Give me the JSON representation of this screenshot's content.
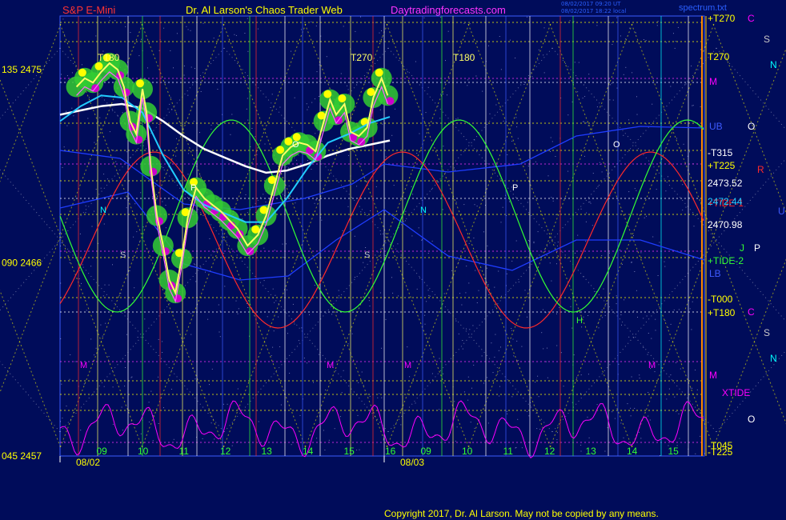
{
  "header": {
    "symbol": "S&P E-Mini",
    "site_title": "Dr. Al Larson's Chaos Trader Web",
    "url": "Daytradingforecasts.com",
    "stamp_line1": "08/02/2017 09:20 UT",
    "stamp_line2": "08/02/2017 18:22 local",
    "spectrum": "spectrum.txt"
  },
  "copyright": "Copyright 2017, Dr. Al Larson. May not be copied by any means.",
  "chart_data": {
    "type": "line",
    "price_axis": {
      "ticks": [
        {
          "value": 2475,
          "label": "135  2475"
        },
        {
          "value": 2466,
          "label": "090  2466"
        },
        {
          "value": 2457,
          "label": "045  2457"
        }
      ],
      "ylim": [
        2457,
        2477.5
      ]
    },
    "x_axis": {
      "days": [
        {
          "label": "08/02",
          "start_hour": 8
        },
        {
          "label": "08/03",
          "start_hour": 8
        }
      ],
      "day1_hour_labels": [
        "09",
        "10",
        "11",
        "12",
        "13",
        "14",
        "15",
        "16"
      ],
      "day2_hour_labels": [
        "09",
        "10",
        "11",
        "12",
        "13",
        "14",
        "15"
      ]
    },
    "right_price_labels": [
      {
        "label": "2473.52",
        "value": 2473.52
      },
      {
        "label": "2472.44",
        "value": 2472.44
      },
      {
        "label": "2470.98",
        "value": 2470.98
      }
    ],
    "right_labels": [
      {
        "text": "+T270",
        "color": "#ffff00"
      },
      {
        "text": "T270",
        "color": "#ffff00"
      },
      {
        "text": "M",
        "color": "#ff00ff"
      },
      {
        "text": "UB",
        "color": "#3d5bff"
      },
      {
        "text": "-T315",
        "color": "#ffffff"
      },
      {
        "text": "+T225",
        "color": "#ffff00"
      },
      {
        "text": "+TIDE-1",
        "color": "#ff2a2a"
      },
      {
        "text": "+TIDE-2",
        "color": "#33ff33"
      },
      {
        "text": "LB",
        "color": "#3d5bff"
      },
      {
        "text": "-T000",
        "color": "#ffff00"
      },
      {
        "text": "+T180",
        "color": "#ffff00"
      },
      {
        "text": "M",
        "color": "#ff00ff"
      },
      {
        "text": "XTIDE",
        "color": "#ff00ff"
      },
      {
        "text": "-T045",
        "color": "#ffff00"
      },
      {
        "text": "-T225",
        "color": "#ffff00"
      }
    ],
    "far_right_letters": [
      {
        "text": "C",
        "color": "#ff00ff"
      },
      {
        "text": "S",
        "color": "#c8c8c8"
      },
      {
        "text": "N",
        "color": "#00ffff"
      },
      {
        "text": "O",
        "color": "#ffffff"
      },
      {
        "text": "R",
        "color": "#ff2a2a"
      },
      {
        "text": "U",
        "color": "#3d5bff"
      },
      {
        "text": "J",
        "color": "#33ff33"
      },
      {
        "text": "P",
        "color": "#ffffff"
      },
      {
        "text": "C",
        "color": "#ff00ff"
      },
      {
        "text": "S",
        "color": "#c8c8c8"
      },
      {
        "text": "N",
        "color": "#00ffff"
      },
      {
        "text": "O",
        "color": "#ffffff"
      }
    ],
    "top_labels": [
      "T180",
      "T270",
      "T180"
    ],
    "in_chart_letters": [
      "O",
      "P",
      "N",
      "S",
      "O",
      "P",
      "N",
      "S",
      "M",
      "M",
      "M",
      "M",
      "H"
    ],
    "price_series": [
      {
        "h": 8.4,
        "v": 2474.2
      },
      {
        "h": 8.6,
        "v": 2474.6
      },
      {
        "h": 8.8,
        "v": 2474.4
      },
      {
        "h": 9.0,
        "v": 2474.9
      },
      {
        "h": 9.2,
        "v": 2475.3
      },
      {
        "h": 9.4,
        "v": 2475.0
      },
      {
        "h": 9.55,
        "v": 2474.2
      },
      {
        "h": 9.7,
        "v": 2472.6
      },
      {
        "h": 9.85,
        "v": 2472.0
      },
      {
        "h": 10.0,
        "v": 2474.1
      },
      {
        "h": 10.1,
        "v": 2473.0
      },
      {
        "h": 10.2,
        "v": 2470.5
      },
      {
        "h": 10.35,
        "v": 2468.2
      },
      {
        "h": 10.5,
        "v": 2466.8
      },
      {
        "h": 10.65,
        "v": 2465.2
      },
      {
        "h": 10.8,
        "v": 2464.6
      },
      {
        "h": 10.95,
        "v": 2466.2
      },
      {
        "h": 11.1,
        "v": 2468.1
      },
      {
        "h": 11.3,
        "v": 2469.5
      },
      {
        "h": 11.5,
        "v": 2469.0
      },
      {
        "h": 11.7,
        "v": 2468.7
      },
      {
        "h": 11.9,
        "v": 2468.4
      },
      {
        "h": 12.1,
        "v": 2468.0
      },
      {
        "h": 12.3,
        "v": 2467.6
      },
      {
        "h": 12.55,
        "v": 2466.8
      },
      {
        "h": 12.8,
        "v": 2467.3
      },
      {
        "h": 13.0,
        "v": 2468.2
      },
      {
        "h": 13.2,
        "v": 2469.6
      },
      {
        "h": 13.4,
        "v": 2471.0
      },
      {
        "h": 13.6,
        "v": 2471.4
      },
      {
        "h": 13.8,
        "v": 2471.6
      },
      {
        "h": 14.0,
        "v": 2471.5
      },
      {
        "h": 14.2,
        "v": 2471.2
      },
      {
        "h": 14.4,
        "v": 2472.6
      },
      {
        "h": 14.55,
        "v": 2473.6
      },
      {
        "h": 14.7,
        "v": 2472.9
      },
      {
        "h": 14.9,
        "v": 2473.4
      },
      {
        "h": 15.05,
        "v": 2472.1
      },
      {
        "h": 15.25,
        "v": 2471.9
      },
      {
        "h": 15.45,
        "v": 2472.3
      },
      {
        "h": 15.6,
        "v": 2473.7
      },
      {
        "h": 15.8,
        "v": 2474.6
      },
      {
        "h": 15.95,
        "v": 2473.8
      }
    ],
    "cyan_series": [
      {
        "h": 8.0,
        "v": 2472.6
      },
      {
        "h": 8.5,
        "v": 2473.3
      },
      {
        "h": 9.0,
        "v": 2473.8
      },
      {
        "h": 9.5,
        "v": 2473.7
      },
      {
        "h": 10.0,
        "v": 2473.0
      },
      {
        "h": 10.5,
        "v": 2471.0
      },
      {
        "h": 11.0,
        "v": 2469.4
      },
      {
        "h": 11.5,
        "v": 2468.7
      },
      {
        "h": 12.0,
        "v": 2468.3
      },
      {
        "h": 12.5,
        "v": 2467.9
      },
      {
        "h": 13.0,
        "v": 2467.9
      },
      {
        "h": 13.5,
        "v": 2469.0
      },
      {
        "h": 14.0,
        "v": 2470.4
      },
      {
        "h": 14.5,
        "v": 2471.6
      },
      {
        "h": 15.0,
        "v": 2472.0
      },
      {
        "h": 15.5,
        "v": 2472.5
      },
      {
        "h": 16.0,
        "v": 2472.8
      }
    ],
    "white_series": [
      {
        "h": 8.0,
        "v": 2472.9
      },
      {
        "h": 8.5,
        "v": 2473.1
      },
      {
        "h": 9.0,
        "v": 2473.3
      },
      {
        "h": 9.5,
        "v": 2473.4
      },
      {
        "h": 10.0,
        "v": 2473.2
      },
      {
        "h": 10.5,
        "v": 2472.6
      },
      {
        "h": 11.0,
        "v": 2471.9
      },
      {
        "h": 11.5,
        "v": 2471.3
      },
      {
        "h": 12.0,
        "v": 2470.9
      },
      {
        "h": 12.5,
        "v": 2470.5
      },
      {
        "h": 13.0,
        "v": 2470.2
      },
      {
        "h": 13.5,
        "v": 2470.3
      },
      {
        "h": 14.0,
        "v": 2470.6
      },
      {
        "h": 14.5,
        "v": 2471.0
      },
      {
        "h": 15.0,
        "v": 2471.3
      },
      {
        "h": 15.5,
        "v": 2471.5
      },
      {
        "h": 16.0,
        "v": 2471.7
      }
    ],
    "colors": {
      "background": "#000c5a",
      "price": "#ffff66",
      "price_up": "#ffff00",
      "price_down": "#cc00cc",
      "band": "#33cc33",
      "cyan": "#22ccff",
      "white": "#ffffff",
      "tide1": "#ff2a2a",
      "tide2": "#33ff33",
      "xtide": "#ff00ff",
      "blue_band": "#1f3dff",
      "grid": "#ffff00"
    }
  }
}
